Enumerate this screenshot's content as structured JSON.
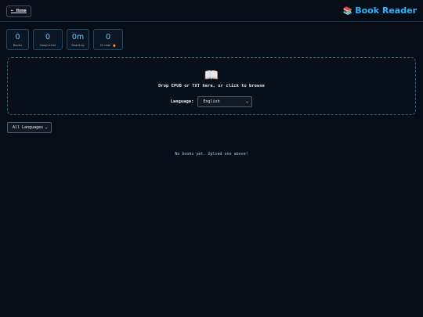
{
  "header": {
    "home_label": "← Home",
    "brand_emoji": "📚",
    "brand_title": "Book Reader"
  },
  "stats": [
    {
      "value": "0",
      "label": "Books"
    },
    {
      "value": "0",
      "label": "Completed"
    },
    {
      "value": "0m",
      "label": "Reading"
    },
    {
      "value": "0",
      "label": "Streak 🔥"
    }
  ],
  "upload": {
    "icon": "📖",
    "instruction": "Drop EPUB or TXT here, or click to browse",
    "language_label": "Language:",
    "language_selected": "English"
  },
  "filter": {
    "selected": "All Languages"
  },
  "library": {
    "empty_message": "No books yet. Upload one above!"
  },
  "colors": {
    "background": "#070d17",
    "accent": "#2fb5ff",
    "stat_value": "#6cc6ff",
    "border": "#1f4a6b"
  },
  "icons": {
    "brand": "books-emoji-icon",
    "dropzone": "open-book-emoji-icon",
    "select_chevron": "chevron-down-icon",
    "streak": "fire-emoji-icon"
  }
}
